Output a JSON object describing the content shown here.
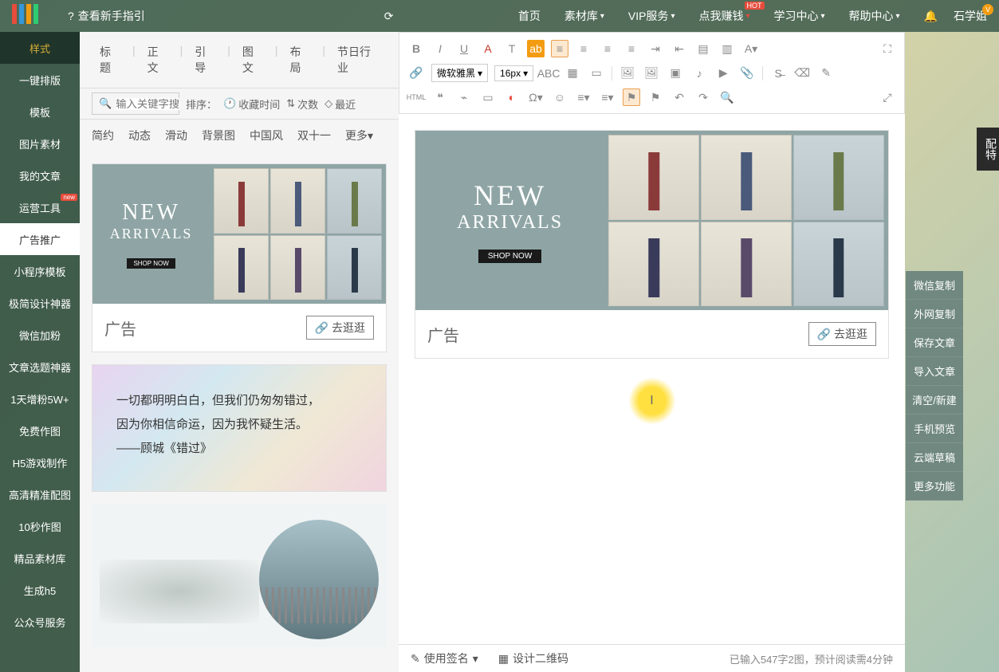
{
  "topbar": {
    "guide": "查看新手指引",
    "nav": [
      "首页",
      "素材库",
      "VIP服务",
      "点我赚钱",
      "学习中心",
      "帮助中心"
    ],
    "hot_badge": "HOT",
    "user": "石学姐"
  },
  "sidebar": {
    "items": [
      "样式",
      "一键排版",
      "模板",
      "图片素材",
      "我的文章",
      "运营工具",
      "广告推广",
      "小程序模板",
      "极简设计神器",
      "微信加粉",
      "文章选题神器",
      "1天增粉5W+",
      "免费作图",
      "H5游戏制作",
      "高清精准配图",
      "10秒作图",
      "精品素材库",
      "生成h5",
      "公众号服务"
    ],
    "new_badge": "new"
  },
  "tabs": [
    "标题",
    "正文",
    "引导",
    "图文",
    "布局",
    "节日行业"
  ],
  "search": {
    "placeholder": "输入关键字搜",
    "sort": "排序：",
    "opts": [
      "收藏时间",
      "次数",
      "最近"
    ]
  },
  "filters": [
    "简约",
    "动态",
    "滑动",
    "背景图",
    "中国风",
    "双十一",
    "更多"
  ],
  "card": {
    "title1": "NEW",
    "title2": "ARRIVALS",
    "shop_btn": "SHOP NOW",
    "label": "广告",
    "visit_btn": "去逛逛"
  },
  "quote": {
    "line1": "一切都明明白白，但我们仍匆匆错过，",
    "line2": "因为你相信命运，因为我怀疑生活。",
    "line3": "——顾城《错过》"
  },
  "toolbar": {
    "font": "微软雅黑",
    "size": "16px",
    "html": "HTML"
  },
  "right_panel": [
    "微信复制",
    "外网复制",
    "保存文章",
    "导入文章",
    "清空/新建",
    "手机预览",
    "云端草稿",
    "更多功能"
  ],
  "config_tab": "配特",
  "status": {
    "sign": "使用签名",
    "qr": "设计二维码",
    "stats": "已输入547字2图，预计阅读需4分钟"
  }
}
